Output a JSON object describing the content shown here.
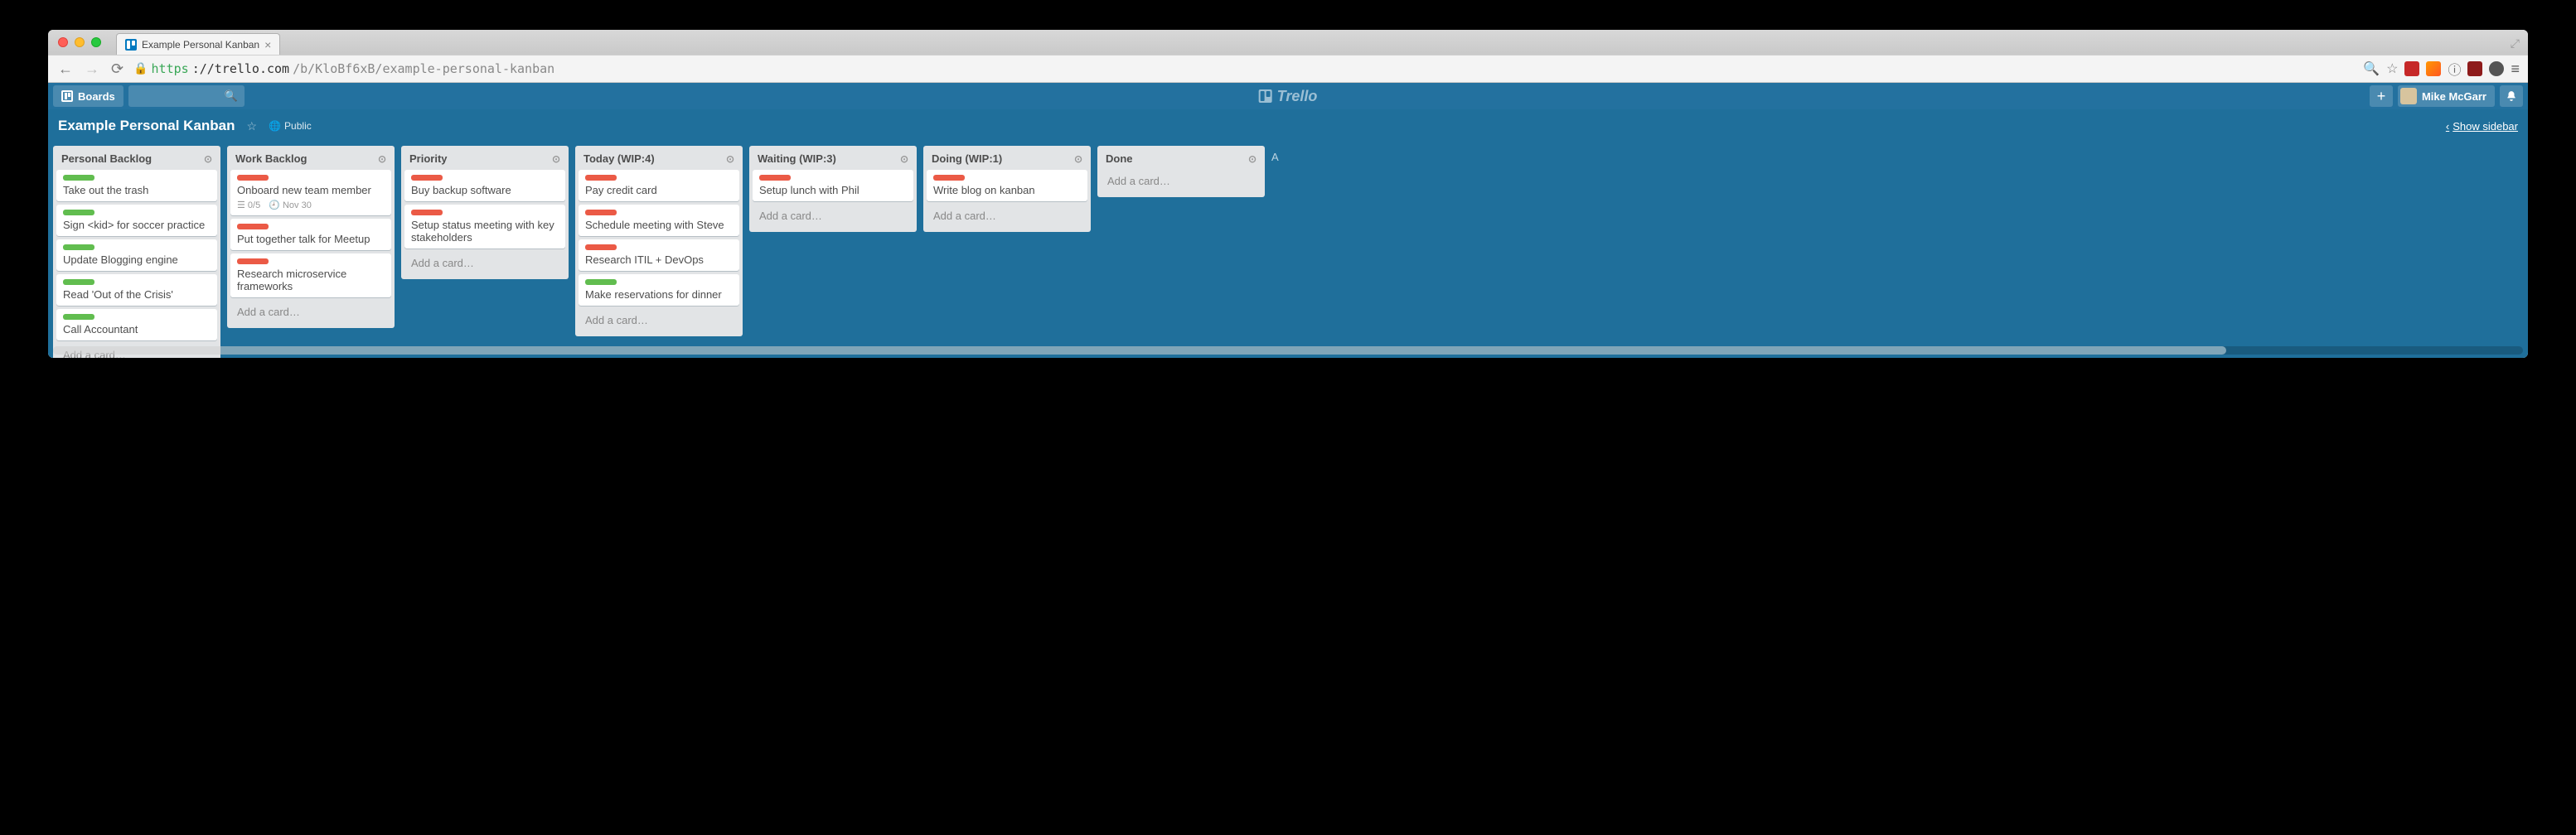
{
  "browser": {
    "tab_title": "Example Personal Kanban",
    "url_scheme": "https",
    "url_host": "://trello.com",
    "url_path": "/b/KloBf6xB/example-personal-kanban"
  },
  "header": {
    "boards_label": "Boards",
    "logo_text": "Trello",
    "user_name": "Mike McGarr"
  },
  "board": {
    "name": "Example Personal Kanban",
    "visibility": "Public",
    "show_sidebar": "Show sidebar"
  },
  "add_card_label": "Add a card…",
  "lists": [
    {
      "title": "Personal Backlog",
      "cards": [
        {
          "labels": [
            "green"
          ],
          "text": "Take out the trash"
        },
        {
          "labels": [
            "green"
          ],
          "text": "Sign <kid> for soccer practice"
        },
        {
          "labels": [
            "green"
          ],
          "text": "Update Blogging engine"
        },
        {
          "labels": [
            "green"
          ],
          "text": "Read 'Out of the Crisis'"
        },
        {
          "labels": [
            "green"
          ],
          "text": "Call Accountant"
        }
      ]
    },
    {
      "title": "Work Backlog",
      "cards": [
        {
          "labels": [
            "red"
          ],
          "text": "Onboard new team member",
          "badges": {
            "checklist": "0/5",
            "due": "Nov 30"
          }
        },
        {
          "labels": [
            "red"
          ],
          "text": "Put together talk for Meetup"
        },
        {
          "labels": [
            "red"
          ],
          "text": "Research microservice frameworks"
        }
      ]
    },
    {
      "title": "Priority",
      "cards": [
        {
          "labels": [
            "red"
          ],
          "text": "Buy backup software"
        },
        {
          "labels": [
            "red"
          ],
          "text": "Setup status meeting with key stakeholders"
        }
      ]
    },
    {
      "title": "Today (WIP:4)",
      "cards": [
        {
          "labels": [
            "red"
          ],
          "text": "Pay credit card"
        },
        {
          "labels": [
            "red"
          ],
          "text": "Schedule meeting with Steve"
        },
        {
          "labels": [
            "red"
          ],
          "text": "Research ITIL + DevOps"
        },
        {
          "labels": [
            "green"
          ],
          "text": "Make reservations for dinner"
        }
      ]
    },
    {
      "title": "Waiting (WIP:3)",
      "cards": [
        {
          "labels": [
            "red"
          ],
          "text": "Setup lunch with Phil"
        }
      ]
    },
    {
      "title": "Doing (WIP:1)",
      "cards": [
        {
          "labels": [
            "red"
          ],
          "text": "Write blog on kanban"
        }
      ]
    },
    {
      "title": "Done",
      "cards": []
    }
  ],
  "add_list_hint": "A"
}
